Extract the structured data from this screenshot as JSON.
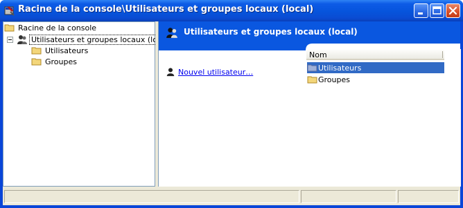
{
  "window": {
    "title": "Racine de la console\\Utilisateurs et groupes locaux (local)",
    "colors": {
      "titlebar": "#0a54da",
      "header": "#0a57e0",
      "selection": "#316ac5",
      "link": "#0000ee",
      "frame": "#ece9d8"
    }
  },
  "tree": {
    "root": "Racine de la console",
    "snapin": "Utilisateurs et groupes locaux (local)",
    "children": [
      "Utilisateurs",
      "Groupes"
    ]
  },
  "content": {
    "header_title": "Utilisateurs et groupes locaux (local)",
    "task_link": "Nouvel utilisateur…",
    "list": {
      "column": "Nom",
      "items": [
        {
          "label": "Utilisateurs",
          "icon": "users-folder-icon",
          "selected": true
        },
        {
          "label": "Groupes",
          "icon": "folder-icon",
          "selected": false
        }
      ]
    }
  },
  "icons": {
    "title": "console-tool-icon",
    "folder": "folder-icon",
    "snapin": "users-snapin-icon",
    "minimize": "minimize-icon",
    "maximize": "maximize-icon",
    "close": "close-icon"
  }
}
